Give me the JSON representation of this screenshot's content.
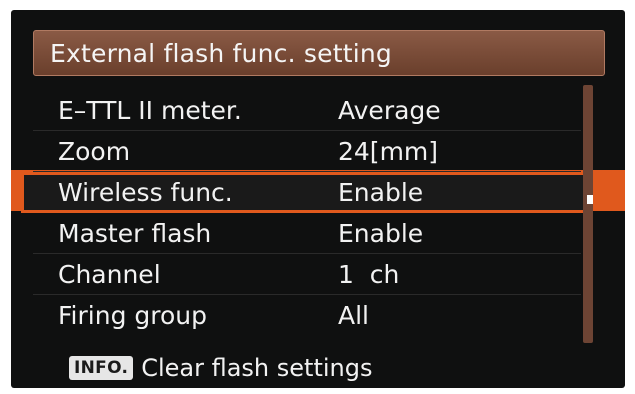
{
  "menu": {
    "title": "External flash func. setting",
    "items": [
      {
        "label": "E–TTL II meter.",
        "value": "Average"
      },
      {
        "label": "Zoom",
        "value": "24[mm]"
      },
      {
        "label": "Wireless func.",
        "value": "Enable"
      },
      {
        "label": "Master flash",
        "value": "Enable"
      },
      {
        "label": "Channel",
        "value": "1  ch"
      },
      {
        "label": "Firing group",
        "value": "All"
      }
    ],
    "selected_index": 2
  },
  "footer": {
    "button_label": "INFO.",
    "action_text": "Clear flash settings"
  },
  "colors": {
    "title_bar": "#7a4c38",
    "selection": "#e0591d",
    "background": "#0f1010",
    "scrollbar": "#6d4434"
  }
}
